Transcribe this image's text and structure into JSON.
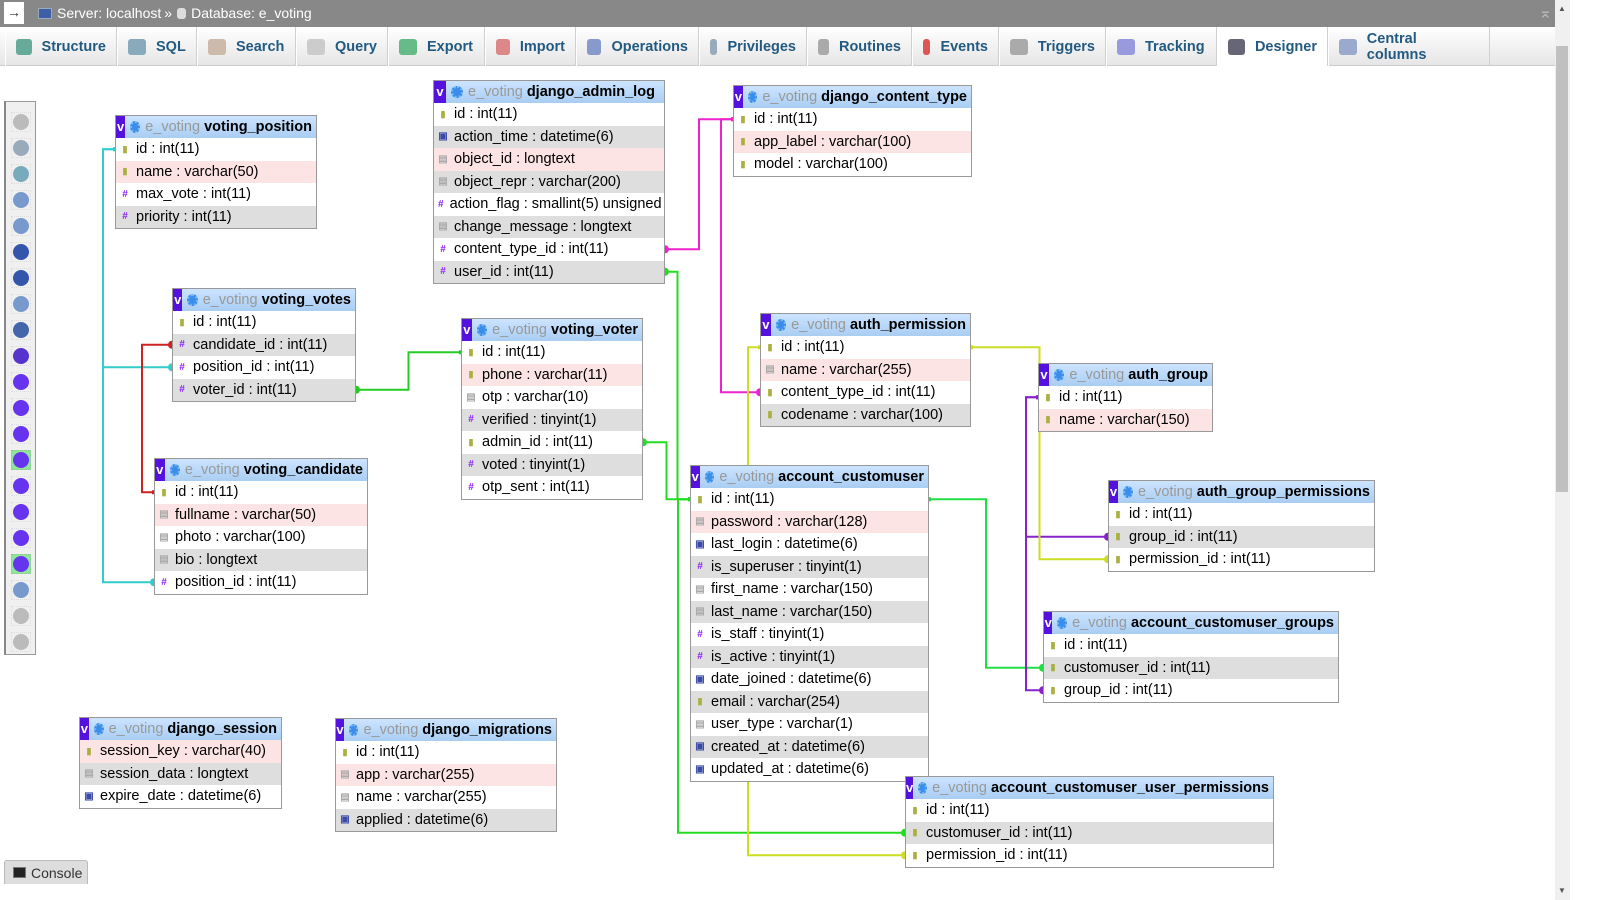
{
  "breadcrumb": {
    "server": "Server: localhost",
    "sep": "»",
    "database": "Database: e_voting"
  },
  "tabs": [
    {
      "label": "Structure",
      "icon": "structure-icon",
      "color": "#6a9"
    },
    {
      "label": "SQL",
      "icon": "sql-icon",
      "color": "#8ab"
    },
    {
      "label": "Search",
      "icon": "search-icon",
      "color": "#cba"
    },
    {
      "label": "Query",
      "icon": "query-icon",
      "color": "#ccc"
    },
    {
      "label": "Export",
      "icon": "export-icon",
      "color": "#6b8"
    },
    {
      "label": "Import",
      "icon": "import-icon",
      "color": "#d88"
    },
    {
      "label": "Operations",
      "icon": "operations-icon",
      "color": "#89c"
    },
    {
      "label": "Privileges",
      "icon": "privileges-icon",
      "color": "#9ab"
    },
    {
      "label": "Routines",
      "icon": "routines-icon",
      "color": "#aaa"
    },
    {
      "label": "Events",
      "icon": "events-icon",
      "color": "#d55"
    },
    {
      "label": "Triggers",
      "icon": "triggers-icon",
      "color": "#aaa"
    },
    {
      "label": "Tracking",
      "icon": "tracking-icon",
      "color": "#99d"
    },
    {
      "label": "Designer",
      "icon": "designer-icon",
      "color": "#667",
      "active": true
    },
    {
      "label": "Central columns",
      "icon": "central-columns-icon",
      "color": "#9ac"
    }
  ],
  "side_menu": [
    {
      "name": "toggle-menu-icon",
      "color": "#bbb"
    },
    {
      "name": "fullscreen-icon",
      "color": "#9ab"
    },
    {
      "name": "add-tables-icon",
      "color": "#7ab"
    },
    {
      "name": "new-page-icon",
      "color": "#79c"
    },
    {
      "name": "edit-page-icon",
      "color": "#79c"
    },
    {
      "name": "save-icon",
      "color": "#35a"
    },
    {
      "name": "save-as-icon",
      "color": "#35a"
    },
    {
      "name": "delete-page-icon",
      "color": "#79c"
    },
    {
      "name": "table-list-icon",
      "color": "#46a"
    },
    {
      "name": "create-relation-icon",
      "color": "#53c"
    },
    {
      "name": "reload-icon",
      "color": "#63e"
    },
    {
      "name": "help-icon",
      "color": "#63e"
    },
    {
      "name": "angular-links-icon",
      "color": "#63e"
    },
    {
      "name": "direct-links-icon",
      "color": "#63e",
      "highlight": true
    },
    {
      "name": "snap-to-grid-icon",
      "color": "#63e"
    },
    {
      "name": "small-big-all-icon",
      "color": "#63e"
    },
    {
      "name": "toggle-small-big-icon",
      "color": "#63e"
    },
    {
      "name": "relation-lines-icon",
      "color": "#63e",
      "highlight": true
    },
    {
      "name": "export-schema-icon",
      "color": "#79c"
    },
    {
      "name": "move-menu-icon",
      "color": "#bbb"
    },
    {
      "name": "pin-text-icon",
      "color": "#bbb"
    }
  ],
  "db_prefix": "e_voting",
  "tables": [
    {
      "id": "voting_position",
      "name": "voting_position",
      "cols": [
        {
          "t": "key",
          "n": "id : int(11)"
        },
        {
          "t": "key",
          "n": "name : varchar(50)",
          "bg": "p"
        },
        {
          "t": "hash",
          "n": "max_vote : int(11)"
        },
        {
          "t": "hash",
          "n": "priority : int(11)",
          "bg": "g"
        }
      ]
    },
    {
      "id": "django_admin_log",
      "name": "django_admin_log",
      "cols": [
        {
          "t": "key",
          "n": "id : int(11)"
        },
        {
          "t": "date",
          "n": "action_time : datetime(6)",
          "bg": "g"
        },
        {
          "t": "text",
          "n": "object_id : longtext",
          "bg": "p"
        },
        {
          "t": "text",
          "n": "object_repr : varchar(200)",
          "bg": "g"
        },
        {
          "t": "hash",
          "n": "action_flag : smallint(5) unsigned"
        },
        {
          "t": "text",
          "n": "change_message : longtext",
          "bg": "g"
        },
        {
          "t": "hash",
          "n": "content_type_id : int(11)"
        },
        {
          "t": "hash",
          "n": "user_id : int(11)",
          "bg": "g"
        }
      ]
    },
    {
      "id": "django_content_type",
      "name": "django_content_type",
      "cols": [
        {
          "t": "key",
          "n": "id : int(11)"
        },
        {
          "t": "key",
          "n": "app_label : varchar(100)",
          "bg": "p"
        },
        {
          "t": "key",
          "n": "model : varchar(100)"
        }
      ]
    },
    {
      "id": "voting_votes",
      "name": "voting_votes",
      "cols": [
        {
          "t": "key",
          "n": "id : int(11)"
        },
        {
          "t": "hash",
          "n": "candidate_id : int(11)",
          "bg": "g"
        },
        {
          "t": "hash",
          "n": "position_id : int(11)"
        },
        {
          "t": "hash",
          "n": "voter_id : int(11)",
          "bg": "g"
        }
      ]
    },
    {
      "id": "voting_voter",
      "name": "voting_voter",
      "cols": [
        {
          "t": "key",
          "n": "id : int(11)"
        },
        {
          "t": "key",
          "n": "phone : varchar(11)",
          "bg": "p"
        },
        {
          "t": "text",
          "n": "otp : varchar(10)"
        },
        {
          "t": "hash",
          "n": "verified : tinyint(1)",
          "bg": "g"
        },
        {
          "t": "key",
          "n": "admin_id : int(11)"
        },
        {
          "t": "hash",
          "n": "voted : tinyint(1)",
          "bg": "g"
        },
        {
          "t": "hash",
          "n": "otp_sent : int(11)"
        }
      ]
    },
    {
      "id": "auth_permission",
      "name": "auth_permission",
      "cols": [
        {
          "t": "key",
          "n": "id : int(11)"
        },
        {
          "t": "text",
          "n": "name : varchar(255)",
          "bg": "p"
        },
        {
          "t": "key",
          "n": "content_type_id : int(11)"
        },
        {
          "t": "key",
          "n": "codename : varchar(100)",
          "bg": "g"
        }
      ]
    },
    {
      "id": "auth_group",
      "name": "auth_group",
      "cols": [
        {
          "t": "key",
          "n": "id : int(11)"
        },
        {
          "t": "key",
          "n": "name : varchar(150)",
          "bg": "p"
        }
      ]
    },
    {
      "id": "voting_candidate",
      "name": "voting_candidate",
      "cols": [
        {
          "t": "key",
          "n": "id : int(11)"
        },
        {
          "t": "text",
          "n": "fullname : varchar(50)",
          "bg": "p"
        },
        {
          "t": "text",
          "n": "photo : varchar(100)"
        },
        {
          "t": "text",
          "n": "bio : longtext",
          "bg": "g"
        },
        {
          "t": "hash",
          "n": "position_id : int(11)"
        }
      ]
    },
    {
      "id": "account_customuser",
      "name": "account_customuser",
      "cols": [
        {
          "t": "key",
          "n": "id : int(11)"
        },
        {
          "t": "text",
          "n": "password : varchar(128)",
          "bg": "p"
        },
        {
          "t": "date",
          "n": "last_login : datetime(6)"
        },
        {
          "t": "hash",
          "n": "is_superuser : tinyint(1)",
          "bg": "g"
        },
        {
          "t": "text",
          "n": "first_name : varchar(150)"
        },
        {
          "t": "text",
          "n": "last_name : varchar(150)",
          "bg": "g"
        },
        {
          "t": "hash",
          "n": "is_staff : tinyint(1)"
        },
        {
          "t": "hash",
          "n": "is_active : tinyint(1)",
          "bg": "g"
        },
        {
          "t": "date",
          "n": "date_joined : datetime(6)"
        },
        {
          "t": "key",
          "n": "email : varchar(254)",
          "bg": "g"
        },
        {
          "t": "text",
          "n": "user_type : varchar(1)"
        },
        {
          "t": "date",
          "n": "created_at : datetime(6)",
          "bg": "g"
        },
        {
          "t": "date",
          "n": "updated_at : datetime(6)"
        }
      ]
    },
    {
      "id": "auth_group_permissions",
      "name": "auth_group_permissions",
      "cols": [
        {
          "t": "key",
          "n": "id : int(11)"
        },
        {
          "t": "key",
          "n": "group_id : int(11)",
          "bg": "g"
        },
        {
          "t": "key",
          "n": "permission_id : int(11)"
        }
      ]
    },
    {
      "id": "account_customuser_groups",
      "name": "account_customuser_groups",
      "cols": [
        {
          "t": "key",
          "n": "id : int(11)"
        },
        {
          "t": "key",
          "n": "customuser_id : int(11)",
          "bg": "g"
        },
        {
          "t": "key",
          "n": "group_id : int(11)"
        }
      ]
    },
    {
      "id": "django_session",
      "name": "django_session",
      "cols": [
        {
          "t": "key",
          "n": "session_key : varchar(40)",
          "bg": "p"
        },
        {
          "t": "text",
          "n": "session_data : longtext",
          "bg": "g"
        },
        {
          "t": "date",
          "n": "expire_date : datetime(6)"
        }
      ]
    },
    {
      "id": "django_migrations",
      "name": "django_migrations",
      "cols": [
        {
          "t": "key",
          "n": "id : int(11)"
        },
        {
          "t": "text",
          "n": "app : varchar(255)",
          "bg": "p"
        },
        {
          "t": "text",
          "n": "name : varchar(255)"
        },
        {
          "t": "date",
          "n": "applied : datetime(6)",
          "bg": "g"
        }
      ]
    },
    {
      "id": "account_customuser_user_permissions",
      "name": "account_customuser_user_permissions",
      "cols": [
        {
          "t": "key",
          "n": "id : int(11)"
        },
        {
          "t": "key",
          "n": "customuser_id : int(11)",
          "bg": "g"
        },
        {
          "t": "key",
          "n": "permission_id : int(11)"
        }
      ]
    }
  ],
  "relations": [
    {
      "from": "voting_candidate.position_id",
      "to": "voting_position.id",
      "color": "#33cccc"
    },
    {
      "from": "voting_votes.position_id",
      "to": "voting_position.id",
      "color": "#33cccc"
    },
    {
      "from": "voting_votes.candidate_id",
      "to": "voting_candidate.id",
      "color": "#cc2222"
    },
    {
      "from": "voting_votes.voter_id",
      "to": "voting_voter.id",
      "color": "#22cc22"
    },
    {
      "from": "django_admin_log.content_type_id",
      "to": "django_content_type.id",
      "color": "#ee22cc"
    },
    {
      "from": "auth_permission.content_type_id",
      "to": "django_content_type.id",
      "color": "#ee22cc"
    },
    {
      "from": "django_admin_log.user_id",
      "to": "account_customuser.id",
      "color": "#22dd22"
    },
    {
      "from": "voting_voter.admin_id",
      "to": "account_customuser.id",
      "color": "#22dd22"
    },
    {
      "from": "account_customuser_groups.customuser_id",
      "to": "account_customuser.id",
      "color": "#22dd44"
    },
    {
      "from": "account_customuser_user_permissions.customuser_id",
      "to": "account_customuser.id",
      "color": "#22dd22"
    },
    {
      "from": "auth_group_permissions.group_id",
      "to": "auth_group.id",
      "color": "#8822cc"
    },
    {
      "from": "account_customuser_groups.group_id",
      "to": "auth_group.id",
      "color": "#8822cc"
    },
    {
      "from": "auth_group_permissions.permission_id",
      "to": "auth_permission.id",
      "color": "#ccdd22"
    },
    {
      "from": "account_customuser_user_permissions.permission_id",
      "to": "auth_permission.id",
      "color": "#ccdd22"
    }
  ],
  "console": {
    "label": "Console"
  }
}
